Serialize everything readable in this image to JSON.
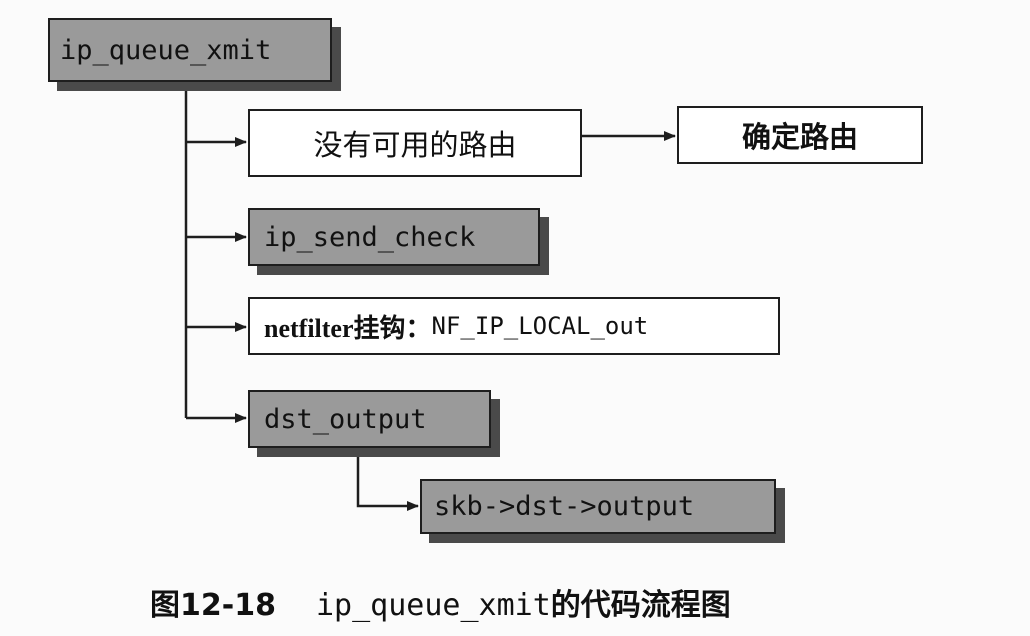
{
  "diagram": {
    "nodes": {
      "ip_queue_xmit": "ip_queue_xmit",
      "no_route": "没有可用的路由",
      "determine_route": "确定路由",
      "ip_send_check": "ip_send_check",
      "netfilter_prefix": "netfilter挂钩：",
      "netfilter_hook": "NF_IP_LOCAL_out",
      "dst_output": "dst_output",
      "skb_dst_output": "skb->dst->output"
    },
    "colors": {
      "gray_box": "#9a9a9a",
      "shadow": "#4a4a4a",
      "line": "#1e1e1e"
    }
  },
  "caption": {
    "figure_number": "图12-18",
    "title_code": "ip_queue_xmit",
    "title_text": "的代码流程图"
  }
}
